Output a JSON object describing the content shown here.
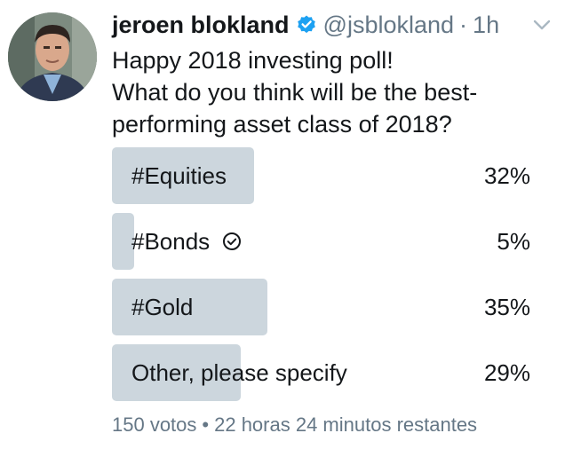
{
  "tweet": {
    "author_name": "jeroen blokland",
    "author_handle": "@jsblokland",
    "separator": "·",
    "time": "1h",
    "text_lines": [
      "Happy 2018 investing poll!",
      "What do you think will be the best-",
      "performing asset class of 2018?"
    ]
  },
  "poll": {
    "options": [
      {
        "label": "#Equities",
        "percent_text": "32%",
        "percent": 32,
        "selected": false
      },
      {
        "label": "#Bonds",
        "percent_text": "5%",
        "percent": 5,
        "selected": true
      },
      {
        "label": "#Gold",
        "percent_text": "35%",
        "percent": 35,
        "selected": false
      },
      {
        "label": "Other, please specify",
        "percent_text": "29%",
        "percent": 29,
        "selected": false
      }
    ],
    "votes": "150 votos",
    "footer_separator": "•",
    "remaining": "22 horas 24 minutos restantes"
  },
  "icons": {
    "verified": "verified-badge-icon",
    "caret": "chevron-down-icon",
    "selected": "check-circle-icon"
  },
  "colors": {
    "bar": "#ccd6dd",
    "verified": "#1da1f2",
    "muted": "#657786",
    "text": "#14171a"
  }
}
